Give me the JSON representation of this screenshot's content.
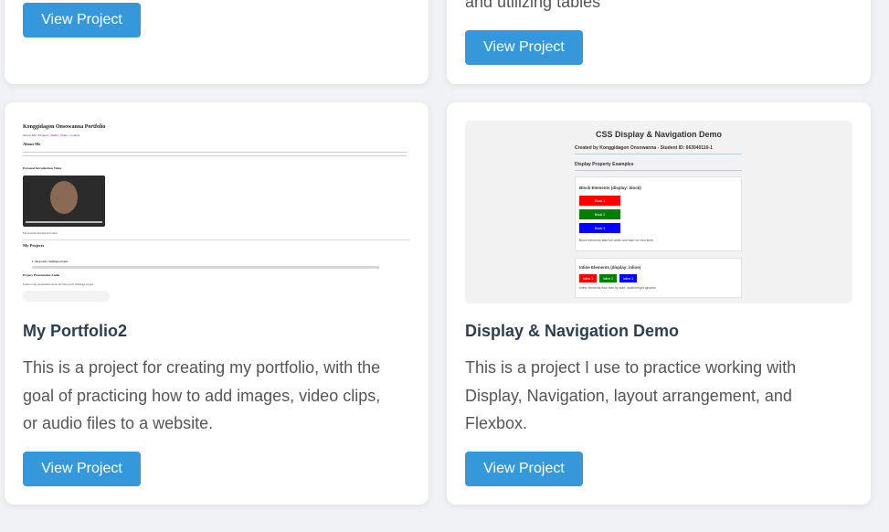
{
  "colors": {
    "button_bg": "#3498db",
    "page_bg": "#f0f2f5",
    "title": "#2c3e50",
    "desc": "#555555"
  },
  "top_cards": [
    {
      "button_label": "View Project"
    },
    {
      "desc_tail": "and utilizing tables",
      "button_label": "View Project"
    }
  ],
  "cards": [
    {
      "title": "My Portfolio2",
      "desc_lines": [
        "This is a project for creating my portfolio, with the",
        "goal of practicing how to add images, video clips,",
        "or audio files to a website."
      ],
      "button_label": "View Project",
      "thumbnail": {
        "page_title": "Konggidagon Onsowanna Portfolio",
        "nav": "About Me | Projects | Skills | Video | Contact",
        "about_heading": "About Me",
        "intro_heading": "Personal Introduction Video",
        "video_caption": "My personal introduction video",
        "projects_heading": "My Projects",
        "project_item": "1. Shop early challenge project.",
        "audio_heading": "Project Presentation Audio",
        "audio_caption": "Listen to my presentation about the Shop early challenge project",
        "video_time": "0:00 / 0:18",
        "audio_time": "0:00 / 0:10"
      }
    },
    {
      "title": "Display & Navigation Demo",
      "desc_lines": [
        "This is a project I use to practice working with",
        "Display, Navigation, layout arrangement, and",
        "Flexbox."
      ],
      "button_label": "View Project",
      "thumbnail": {
        "demo_title": "CSS Display & Navigation Demo",
        "created_by": "Created by Konggidagon Onsowanna - Student ID: 663040110-1",
        "section": "Display Property Examples",
        "block_label": "Block Elements (display: block)",
        "blocks": [
          "Block 1",
          "Block 2",
          "Block 3"
        ],
        "block_note": "Block elements take full width and start on new lines",
        "inline_label": "Inline Elements (display: inline)",
        "inlines": [
          "Inline 1",
          "Inline 2",
          "Inline 3"
        ],
        "inline_note": "Inline elements flow side by side, width/height ignored",
        "block_colors": [
          "#ff0000",
          "#008000",
          "#0000ff"
        ]
      }
    }
  ]
}
